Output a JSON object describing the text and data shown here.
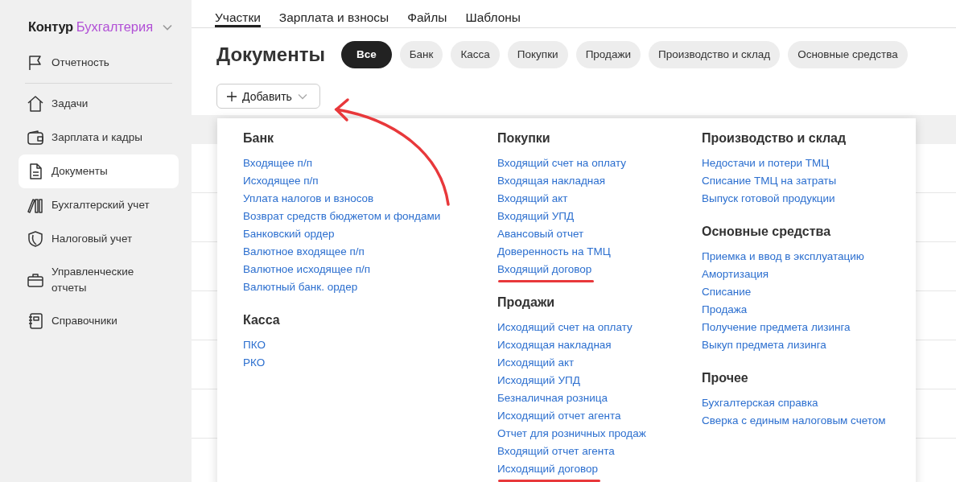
{
  "sidebar": {
    "logo": {
      "brand": "Контур",
      "product": "Бухгалтерия"
    },
    "items": [
      {
        "label": "Отчетность",
        "selected": false
      },
      {
        "label": "Задачи",
        "selected": false
      },
      {
        "label": "Зарплата и кадры",
        "selected": false
      },
      {
        "label": "Документы",
        "selected": true
      },
      {
        "label": "Бухгалтерский учет",
        "selected": false
      },
      {
        "label": "Налоговый учет",
        "selected": false
      },
      {
        "label": "Управленческие отчеты",
        "selected": false
      },
      {
        "label": "Справочники",
        "selected": false
      }
    ]
  },
  "tabs": [
    {
      "label": "Участки",
      "selected": true
    },
    {
      "label": "Зарплата и взносы",
      "selected": false
    },
    {
      "label": "Файлы",
      "selected": false
    },
    {
      "label": "Шаблоны",
      "selected": false
    }
  ],
  "title": "Документы",
  "filters": [
    {
      "label": "Все",
      "selected": true
    },
    {
      "label": "Банк",
      "selected": false
    },
    {
      "label": "Касса",
      "selected": false
    },
    {
      "label": "Покупки",
      "selected": false
    },
    {
      "label": "Продажи",
      "selected": false
    },
    {
      "label": "Производство и склад",
      "selected": false
    },
    {
      "label": "Основные средства",
      "selected": false
    }
  ],
  "add_button": {
    "label": "Добавить"
  },
  "menu": {
    "columns": [
      [
        {
          "title": "Банк",
          "items": [
            {
              "label": "Входящее п/п",
              "marked": false
            },
            {
              "label": "Исходящее п/п",
              "marked": false
            },
            {
              "label": "Уплата налогов и взносов",
              "marked": false
            },
            {
              "label": "Возврат средств бюджетом и фондами",
              "marked": false
            },
            {
              "label": "Банковский ордер",
              "marked": false
            },
            {
              "label": "Валютное входящее п/п",
              "marked": false
            },
            {
              "label": "Валютное исходящее п/п",
              "marked": false
            },
            {
              "label": "Валютный банк. ордер",
              "marked": false
            }
          ]
        },
        {
          "title": "Касса",
          "items": [
            {
              "label": "ПКО",
              "marked": false
            },
            {
              "label": "РКО",
              "marked": false
            }
          ]
        }
      ],
      [
        {
          "title": "Покупки",
          "items": [
            {
              "label": "Входящий счет на оплату",
              "marked": false
            },
            {
              "label": "Входящая накладная",
              "marked": false
            },
            {
              "label": "Входящий акт",
              "marked": false
            },
            {
              "label": "Входящий УПД",
              "marked": false
            },
            {
              "label": "Авансовый отчет",
              "marked": false
            },
            {
              "label": "Доверенность на ТМЦ",
              "marked": false
            },
            {
              "label": "Входящий договор",
              "marked": true
            }
          ]
        },
        {
          "title": "Продажи",
          "items": [
            {
              "label": "Исходящий счет на оплату",
              "marked": false
            },
            {
              "label": "Исходящая накладная",
              "marked": false
            },
            {
              "label": "Исходящий акт",
              "marked": false
            },
            {
              "label": "Исходящий УПД",
              "marked": false
            },
            {
              "label": "Безналичная розница",
              "marked": false
            },
            {
              "label": "Исходящий отчет агента",
              "marked": false
            },
            {
              "label": "Отчет для розничных продаж",
              "marked": false
            },
            {
              "label": "Входящий отчет агента",
              "marked": false
            },
            {
              "label": "Исходящий договор",
              "marked": true
            }
          ]
        }
      ],
      [
        {
          "title": "Производство и склад",
          "items": [
            {
              "label": "Недостачи и потери ТМЦ",
              "marked": false
            },
            {
              "label": "Списание ТМЦ на затраты",
              "marked": false
            },
            {
              "label": "Выпуск готовой продукции",
              "marked": false
            }
          ]
        },
        {
          "title": "Основные средства",
          "items": [
            {
              "label": "Приемка и ввод в эксплуатацию",
              "marked": false
            },
            {
              "label": "Амортизация",
              "marked": false
            },
            {
              "label": "Списание",
              "marked": false
            },
            {
              "label": "Продажа",
              "marked": false
            },
            {
              "label": "Получение предмета лизинга",
              "marked": false
            },
            {
              "label": "Выкуп предмета лизинга",
              "marked": false
            }
          ]
        },
        {
          "title": "Прочее",
          "items": [
            {
              "label": "Бухгалтерская справка",
              "marked": false
            },
            {
              "label": "Сверка с единым налоговым счетом",
              "marked": false
            }
          ]
        }
      ]
    ]
  }
}
